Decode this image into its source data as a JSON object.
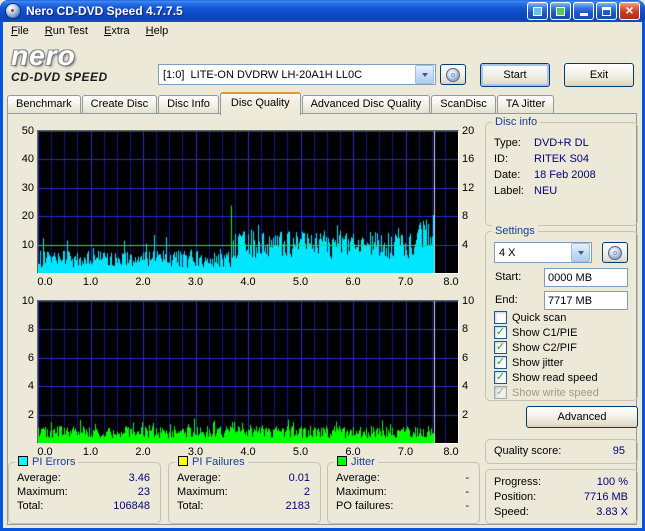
{
  "window": {
    "title": "Nero CD-DVD Speed 4.7.7.5"
  },
  "menu": [
    "File",
    "Run Test",
    "Extra",
    "Help"
  ],
  "logo": {
    "line1": "nero",
    "line2": "CD-DVD SPEED"
  },
  "toolbar": {
    "drive": "[1:0]  LITE-ON DVDRW LH-20A1H LL0C",
    "start": "Start",
    "exit": "Exit"
  },
  "tabs": {
    "items": [
      "Benchmark",
      "Create Disc",
      "Disc Info",
      "Disc Quality",
      "Advanced Disc Quality",
      "ScanDisc",
      "TA Jitter"
    ],
    "active": 3
  },
  "disc_info": {
    "title": "Disc info",
    "rows": [
      [
        "Type:",
        "DVD+R DL"
      ],
      [
        "ID:",
        "RITEK S04"
      ],
      [
        "Date:",
        "18 Feb 2008"
      ],
      [
        "Label:",
        "NEU"
      ]
    ]
  },
  "settings": {
    "title": "Settings",
    "speed": "4 X",
    "start_label": "Start:",
    "start_value": "0000 MB",
    "end_label": "End:",
    "end_value": "7717 MB",
    "checkboxes": [
      {
        "label": "Quick scan",
        "checked": false,
        "disabled": false
      },
      {
        "label": "Show C1/PIE",
        "checked": true,
        "disabled": false
      },
      {
        "label": "Show C2/PIF",
        "checked": true,
        "disabled": false
      },
      {
        "label": "Show jitter",
        "checked": true,
        "disabled": false
      },
      {
        "label": "Show read speed",
        "checked": true,
        "disabled": false
      },
      {
        "label": "Show write speed",
        "checked": true,
        "disabled": true
      }
    ],
    "advanced": "Advanced"
  },
  "quality": {
    "label": "Quality score:",
    "value": "95"
  },
  "progress": {
    "rows": [
      [
        "Progress:",
        "100 %"
      ],
      [
        "Position:",
        "7716 MB"
      ],
      [
        "Speed:",
        "3.83 X"
      ]
    ]
  },
  "stats_panels": [
    {
      "title": "PI Errors",
      "color": "#00FFFF",
      "rows": [
        [
          "Average:",
          "3.46"
        ],
        [
          "Maximum:",
          "23"
        ],
        [
          "Total:",
          "106848"
        ]
      ]
    },
    {
      "title": "PI Failures",
      "color": "#FFFF00",
      "rows": [
        [
          "Average:",
          "0.01"
        ],
        [
          "Maximum:",
          "2"
        ],
        [
          "Total:",
          "2183"
        ]
      ]
    },
    {
      "title": "Jitter",
      "color": "#00FF00",
      "rows": [
        [
          "Average:",
          "-"
        ],
        [
          "Maximum:",
          "-"
        ],
        [
          "PO failures:",
          "-"
        ]
      ]
    }
  ],
  "chart_data": [
    {
      "type": "area",
      "name": "pi_errors_and_read_speed",
      "x": {
        "range": [
          0,
          8
        ],
        "major": 1,
        "minor": 0.25,
        "ticks": [
          "0.0",
          "1.0",
          "2.0",
          "3.0",
          "4.0",
          "5.0",
          "6.0",
          "7.0",
          "8.0"
        ]
      },
      "left_axis": {
        "range": [
          0,
          50
        ],
        "ticks": [
          50,
          40,
          30,
          20,
          10
        ]
      },
      "right_axis": {
        "range": [
          0,
          20
        ],
        "ticks": [
          20,
          16,
          12,
          8,
          4
        ]
      },
      "grid": {
        "major_color": "#2C2CCE",
        "minor_color": "#14148C"
      },
      "data_end": 7.55,
      "series": [
        {
          "name": "PI Errors",
          "axis": "left",
          "style": "spikes",
          "color": "#00E6FF",
          "seed": 20080218,
          "segments": [
            {
              "from": 0,
              "to": 3.67,
              "base": 2,
              "var": 6,
              "spike_chance": 0.08,
              "spike_extra": 7
            },
            {
              "from": 3.67,
              "to": 7.2,
              "base": 5,
              "var": 10,
              "spike_chance": 0.12,
              "spike_extra": 5
            },
            {
              "from": 7.2,
              "to": 7.55,
              "base": 8,
              "var": 11,
              "spike_chance": 0.2,
              "spike_extra": 4
            }
          ],
          "peak": {
            "x": 3.68,
            "value": 23
          },
          "stats": {
            "average": 3.46,
            "maximum": 23,
            "total": 106848
          }
        },
        {
          "name": "Read speed",
          "axis": "right",
          "style": "line",
          "color": "#00FF00",
          "seed": 5,
          "value": 4.0,
          "glitch": {
            "x": 3.68,
            "to_value": 9.5
          }
        }
      ]
    },
    {
      "type": "area",
      "name": "pi_failures",
      "x": {
        "range": [
          0,
          8
        ],
        "major": 1,
        "minor": 0.25,
        "ticks": [
          "0.0",
          "1.0",
          "2.0",
          "3.0",
          "4.0",
          "5.0",
          "6.0",
          "7.0",
          "8.0"
        ]
      },
      "left_axis": {
        "range": [
          0,
          10
        ],
        "ticks": [
          10,
          8,
          6,
          4,
          2
        ]
      },
      "right_axis": {
        "range": [
          0,
          10
        ],
        "ticks": [
          10,
          8,
          6,
          4,
          2
        ]
      },
      "grid": {
        "major_color": "#2C2CCE",
        "minor_color": "#14148C"
      },
      "data_end": 7.55,
      "series": [
        {
          "name": "PI Failures",
          "axis": "left",
          "style": "spikes",
          "color": "#00FF00",
          "seed": 777,
          "segments": [
            {
              "from": 0,
              "to": 7.55,
              "base": 0.35,
              "var": 0.85,
              "spike_chance": 0.1,
              "spike_extra": 0.9
            }
          ],
          "stats": {
            "average": 0.01,
            "maximum": 2,
            "total": 2183
          }
        }
      ]
    }
  ]
}
